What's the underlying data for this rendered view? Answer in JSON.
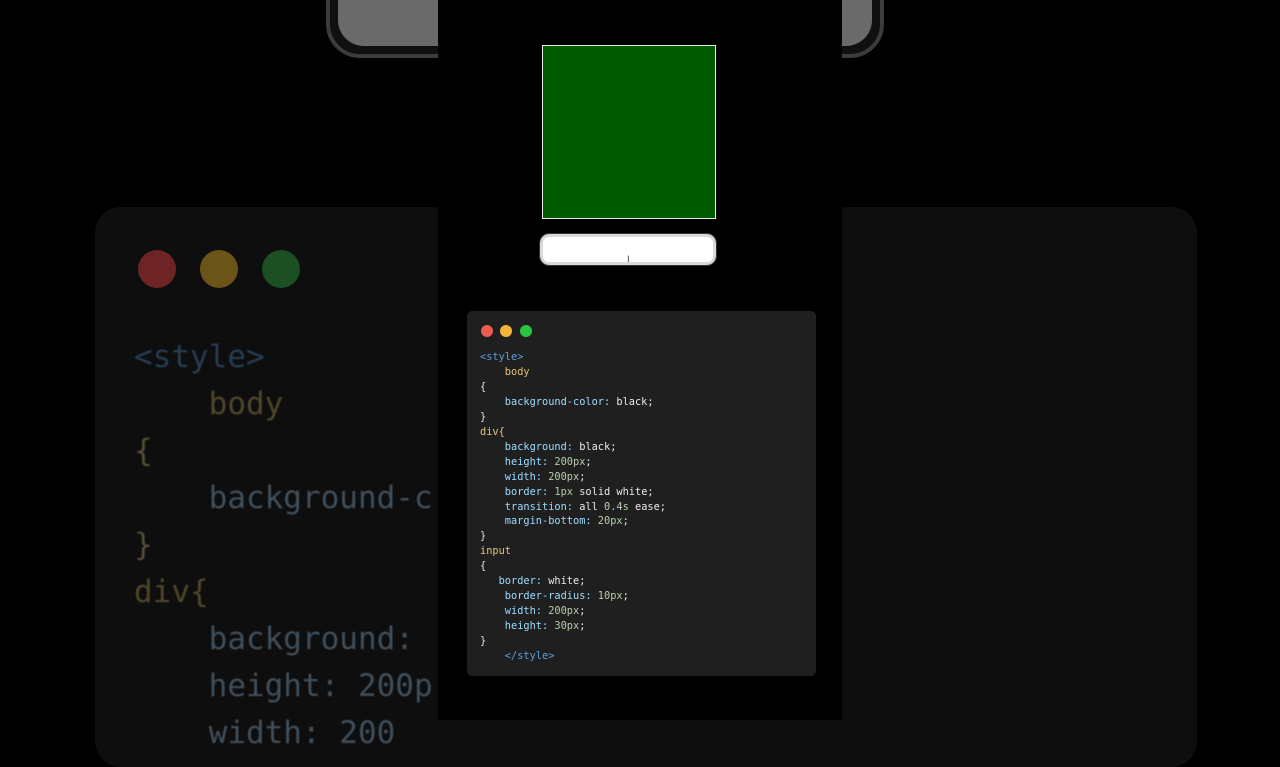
{
  "colors": {
    "demo_box_fill": "#005a00",
    "demo_box_border": "#e6e6e6",
    "card_background": "#1f1f1f",
    "dot_red": "#ed5b52",
    "dot_yellow": "#f4b63a",
    "dot_green": "#29c442"
  },
  "demo": {
    "input_value": "",
    "cursor_glyph": "I"
  },
  "code_lines": [
    "<style>",
    "    body",
    "{",
    "    background-color: black;",
    "}",
    "div{",
    "    background: black;",
    "    height: 200px;",
    "    width: 200px;",
    "    border: 1px solid white;",
    "    transition: all 0.4s ease;",
    "    margin-bottom: 20px;",
    "}",
    "input",
    "{",
    "   border: white;",
    "    border-radius: 10px;",
    "    width: 200px;",
    "    height: 30px;",
    "}",
    "    </style>"
  ],
  "background_code_lines": [
    "<style>",
    "    body",
    "{",
    "    background-c",
    "}",
    "div{",
    "    background:",
    "    height: 200p",
    "    width: 200"
  ]
}
